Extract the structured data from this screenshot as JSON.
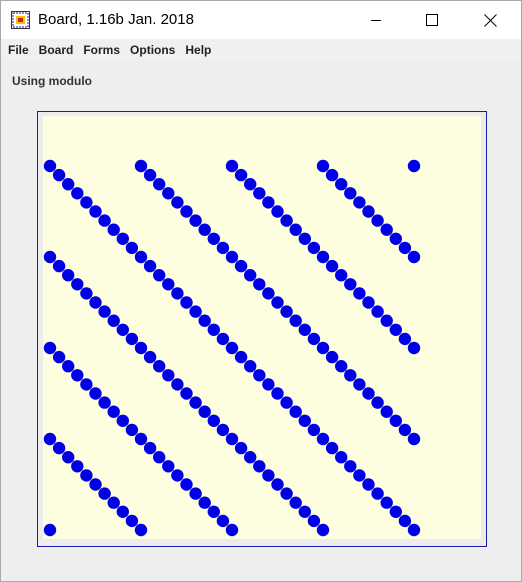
{
  "window": {
    "title": "Board, 1.16b Jan. 2018",
    "icons": {
      "app": "board-app-icon",
      "minimize": "minimize-icon",
      "maximize": "maximize-icon",
      "close": "close-icon"
    }
  },
  "menu": {
    "items": [
      {
        "label": "File"
      },
      {
        "label": "Board"
      },
      {
        "label": "Forms"
      },
      {
        "label": "Options"
      },
      {
        "label": "Help"
      }
    ]
  },
  "main": {
    "status": "Using modulo"
  },
  "board": {
    "background_color": "#fdfde0",
    "dot_color": "#0000e6",
    "border_color": "#1a1aa6",
    "columns": 41,
    "rows": 41,
    "modulo": 10
  }
}
